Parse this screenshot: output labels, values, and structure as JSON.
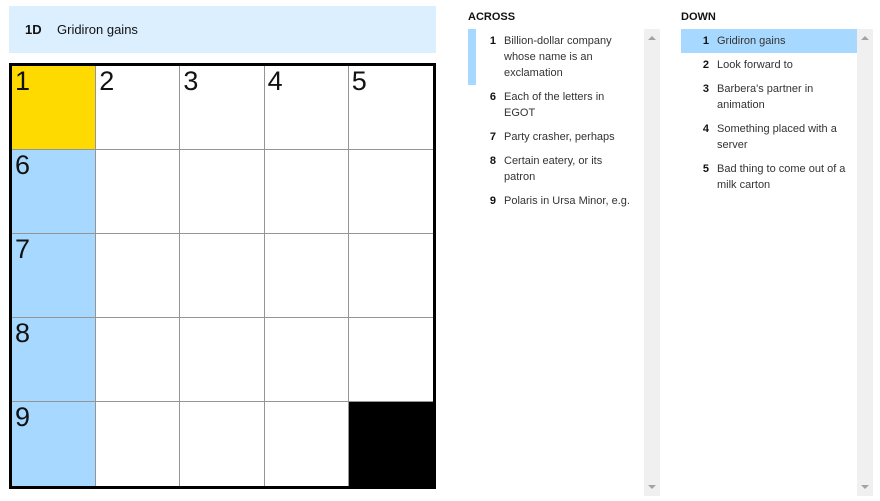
{
  "current_clue": {
    "label": "1D",
    "text": "Gridiron gains"
  },
  "grid": {
    "rows": [
      [
        {
          "num": "1",
          "state": "active"
        },
        {
          "num": "2",
          "state": ""
        },
        {
          "num": "3",
          "state": ""
        },
        {
          "num": "4",
          "state": ""
        },
        {
          "num": "5",
          "state": ""
        }
      ],
      [
        {
          "num": "6",
          "state": "word"
        },
        {
          "num": "",
          "state": ""
        },
        {
          "num": "",
          "state": ""
        },
        {
          "num": "",
          "state": ""
        },
        {
          "num": "",
          "state": ""
        }
      ],
      [
        {
          "num": "7",
          "state": "word"
        },
        {
          "num": "",
          "state": ""
        },
        {
          "num": "",
          "state": ""
        },
        {
          "num": "",
          "state": ""
        },
        {
          "num": "",
          "state": ""
        }
      ],
      [
        {
          "num": "8",
          "state": "word"
        },
        {
          "num": "",
          "state": ""
        },
        {
          "num": "",
          "state": ""
        },
        {
          "num": "",
          "state": ""
        },
        {
          "num": "",
          "state": ""
        }
      ],
      [
        {
          "num": "9",
          "state": "word"
        },
        {
          "num": "",
          "state": ""
        },
        {
          "num": "",
          "state": ""
        },
        {
          "num": "",
          "state": ""
        },
        {
          "num": "",
          "state": "block"
        }
      ]
    ]
  },
  "across": {
    "title": "ACROSS",
    "clues": [
      {
        "num": "1",
        "text": "Billion-dollar company whose name is an exclamation",
        "state": "highlight"
      },
      {
        "num": "6",
        "text": "Each of the letters in EGOT",
        "state": ""
      },
      {
        "num": "7",
        "text": "Party crasher, perhaps",
        "state": ""
      },
      {
        "num": "8",
        "text": "Certain eatery, or its patron",
        "state": ""
      },
      {
        "num": "9",
        "text": "Polaris in Ursa Minor, e.g.",
        "state": ""
      }
    ]
  },
  "down": {
    "title": "DOWN",
    "clues": [
      {
        "num": "1",
        "text": "Gridiron gains",
        "state": "selected"
      },
      {
        "num": "2",
        "text": "Look forward to",
        "state": ""
      },
      {
        "num": "3",
        "text": "Barbera's partner in animation",
        "state": ""
      },
      {
        "num": "4",
        "text": "Something placed with a server",
        "state": ""
      },
      {
        "num": "5",
        "text": "Bad thing to come out of a milk carton",
        "state": ""
      }
    ]
  },
  "colors": {
    "active_cell": "#ffda00",
    "word_highlight": "#a7d8ff",
    "clue_bar": "#dcefff"
  }
}
